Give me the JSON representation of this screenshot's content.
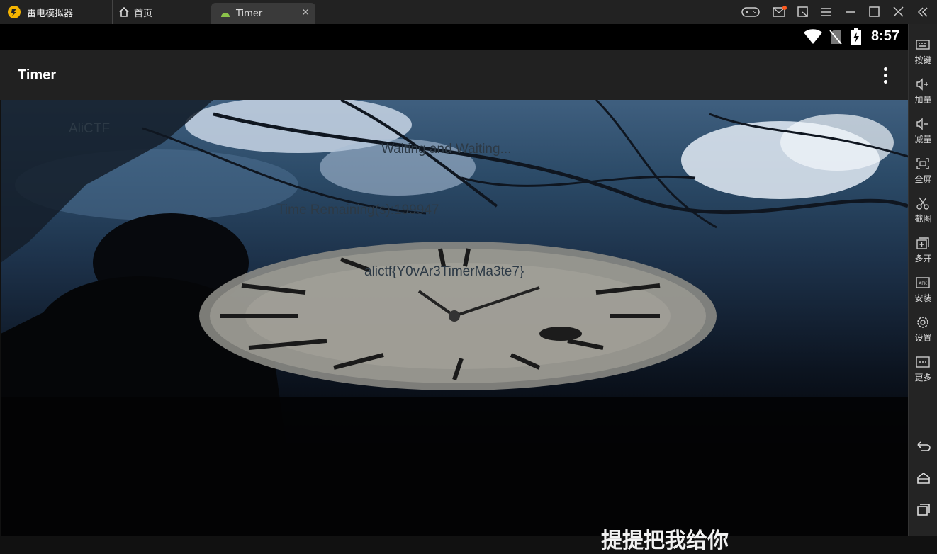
{
  "titlebar": {
    "brand": "雷电模拟器",
    "tabs": [
      {
        "label": "首页",
        "icon": "home-icon"
      },
      {
        "label": "Timer",
        "icon": "android-icon"
      }
    ],
    "controls": [
      "gamepad-icon",
      "mail-icon",
      "external-icon",
      "menu-icon",
      "minimize-icon",
      "maximize-icon",
      "close-icon",
      "collapse-icon"
    ]
  },
  "statusbar": {
    "time": "8:57",
    "icons": [
      "wifi-icon",
      "no-sim-icon",
      "battery-icon"
    ]
  },
  "appbar": {
    "title": "Timer",
    "menu_icon": "more-vert-icon"
  },
  "content": {
    "label_alictf": "AliCTF",
    "waiting": "Waiting and Waiting...",
    "remaining": "Time Remaining(s):199947",
    "flag": "alictf{Y0vAr3TimerMa3te7}",
    "bottom_text": "提提把我给你"
  },
  "sidebar": {
    "items": [
      {
        "label": "按键",
        "icon": "keyboard-icon"
      },
      {
        "label": "加量",
        "icon": "volume-up-icon"
      },
      {
        "label": "减量",
        "icon": "volume-down-icon"
      },
      {
        "label": "全屏",
        "icon": "fullscreen-icon"
      },
      {
        "label": "截图",
        "icon": "scissors-icon"
      },
      {
        "label": "多开",
        "icon": "multi-instance-icon"
      },
      {
        "label": "安装",
        "icon": "apk-icon"
      },
      {
        "label": "设置",
        "icon": "gear-icon"
      },
      {
        "label": "更多",
        "icon": "more-icon"
      }
    ],
    "nav": [
      "back-icon",
      "home-icon",
      "recents-icon"
    ]
  },
  "colors": {
    "titlebar": "#222222",
    "appbar": "#212121",
    "statusbar": "#000000",
    "tab_active": "#3a3a3a",
    "notify_dot": "#ff5a1f",
    "brand_yellow": "#f5b400"
  }
}
